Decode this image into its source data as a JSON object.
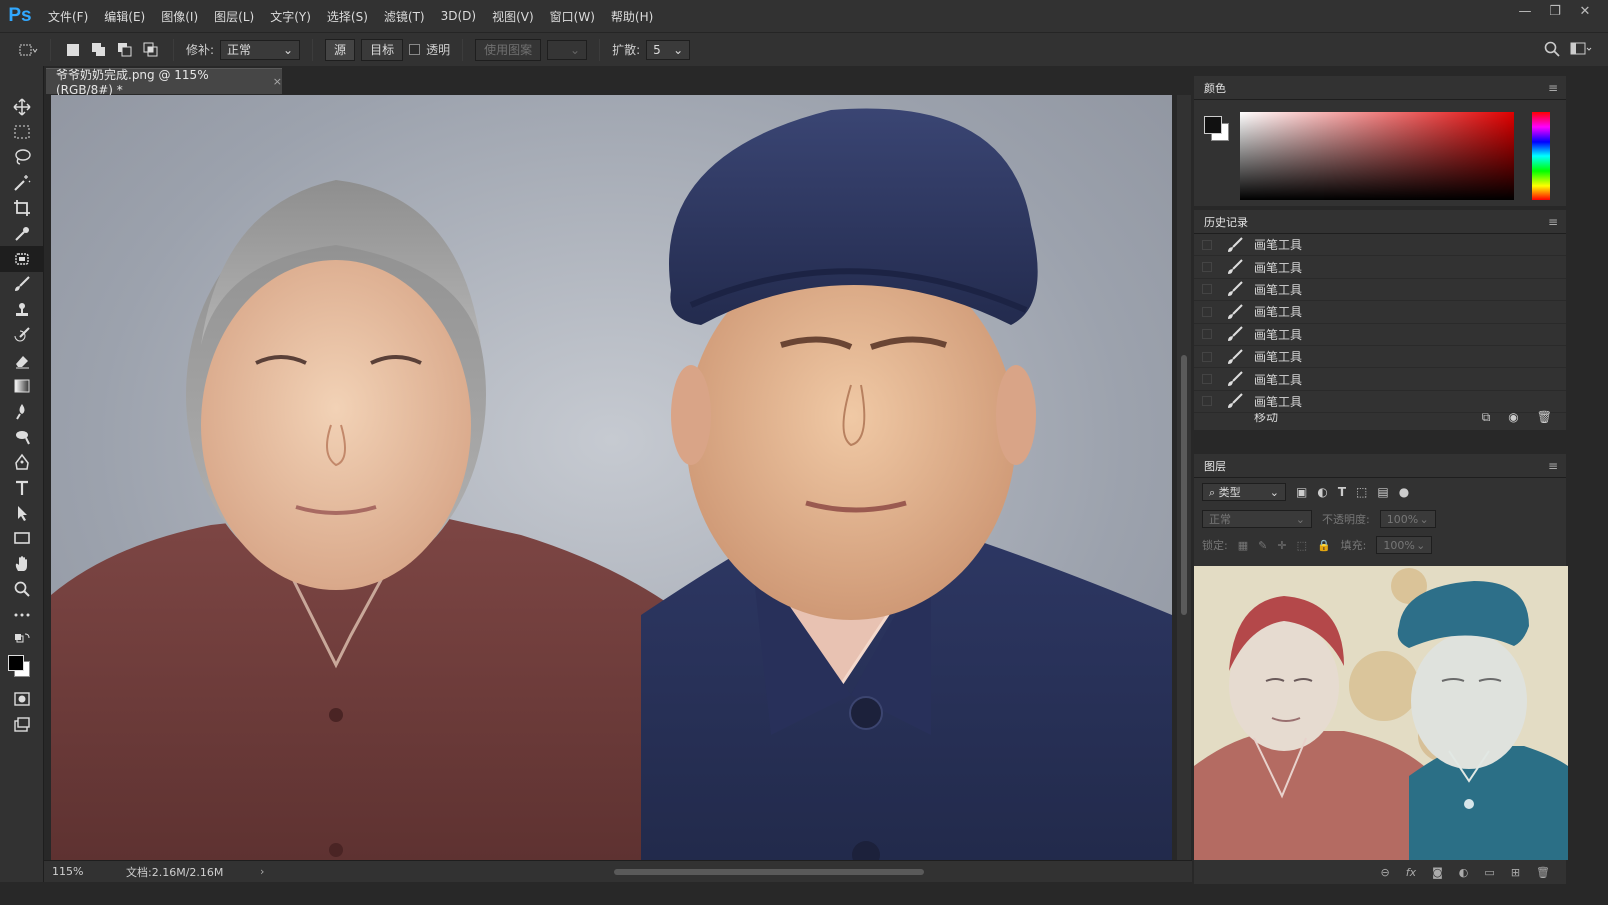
{
  "app": {
    "logo": "Ps"
  },
  "menu": [
    "文件(F)",
    "编辑(E)",
    "图像(I)",
    "图层(L)",
    "文字(Y)",
    "选择(S)",
    "滤镜(T)",
    "3D(D)",
    "视图(V)",
    "窗口(W)",
    "帮助(H)"
  ],
  "window_controls": {
    "minimize": "—",
    "restore": "❐",
    "close": "✕"
  },
  "options": {
    "patch_label": "修补:",
    "patch_mode": "正常",
    "source_label": "源",
    "target_label": "目标",
    "transparent_label": "透明",
    "use_pattern_label": "使用图案",
    "diffusion_label": "扩散:",
    "diffusion_value": "5"
  },
  "document": {
    "tab_title": "爷爷奶奶完成.png @ 115%(RGB/8#) *",
    "close": "×"
  },
  "status": {
    "zoom": "115%",
    "doc_info": "文档:2.16M/2.16M"
  },
  "panels": {
    "color": {
      "title": "颜色"
    },
    "history": {
      "title": "历史记录",
      "items": [
        "画笔工具",
        "画笔工具",
        "画笔工具",
        "画笔工具",
        "画笔工具",
        "画笔工具",
        "画笔工具",
        "画笔工具"
      ],
      "partial_item": "移动"
    },
    "layers": {
      "title": "图层",
      "filter_kind": "类型",
      "blend_mode": "正常",
      "opacity_label": "不透明度:",
      "opacity_value": "100%",
      "lock_label": "锁定:",
      "fill_label": "填充:",
      "fill_value": "100%"
    }
  },
  "colors": {
    "ps_blue": "#31a8ff",
    "panel_bg": "#323232",
    "app_bg": "#282828"
  },
  "icons": [
    "move-icon",
    "marquee-icon",
    "lasso-icon",
    "magic-wand-icon",
    "crop-icon",
    "eyedropper-icon",
    "patch-icon",
    "brush-icon",
    "stamp-icon",
    "history-brush-icon",
    "eraser-icon",
    "gradient-icon",
    "blur-icon",
    "dodge-icon",
    "pen-icon",
    "type-icon",
    "path-select-icon",
    "rectangle-icon",
    "hand-icon",
    "zoom-icon",
    "more-icon"
  ]
}
